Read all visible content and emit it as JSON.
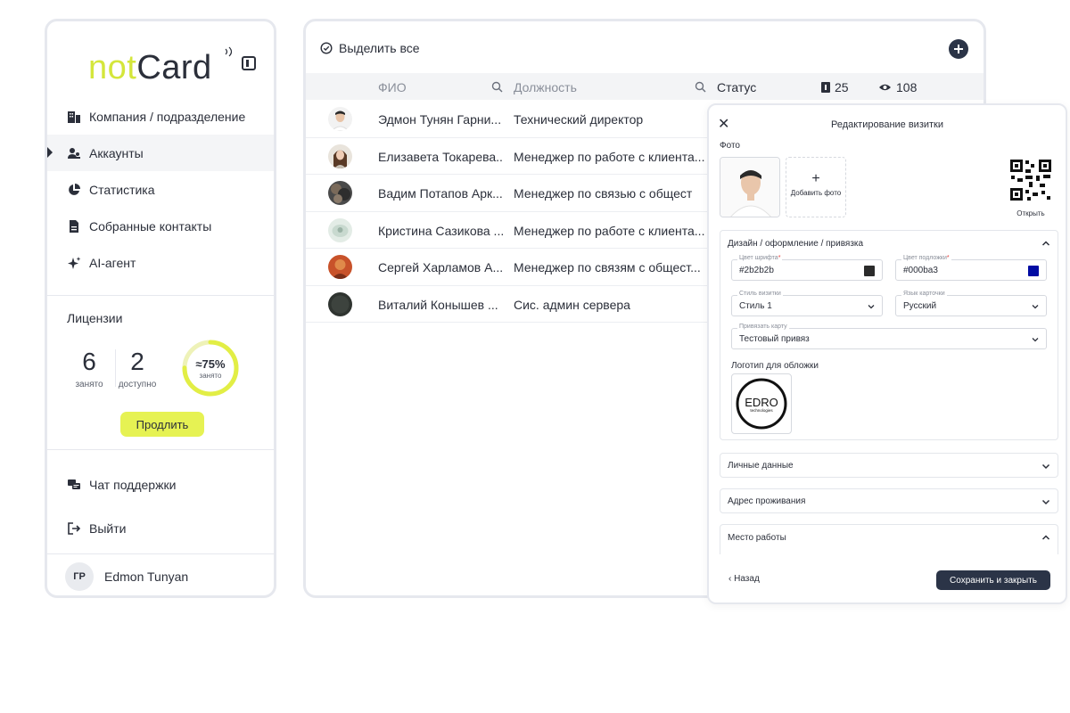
{
  "sidebar": {
    "logo_not": "not",
    "logo_card": "Card",
    "items": [
      {
        "label": "Компания / подразделение",
        "icon": "building-icon"
      },
      {
        "label": "Аккаунты",
        "icon": "users-icon"
      },
      {
        "label": "Статистика",
        "icon": "pie-chart-icon"
      },
      {
        "label": "Собранные контакты",
        "icon": "document-icon"
      },
      {
        "label": "AI-агент",
        "icon": "sparkle-icon"
      }
    ],
    "licenses": {
      "title": "Лицензии",
      "used": "6",
      "used_label": "занято",
      "available": "2",
      "available_label": "доступно",
      "percent_text": "≈75%",
      "percent_label": "занято",
      "percent_value": 75,
      "renew_label": "Продлить"
    },
    "support_label": "Чат поддержки",
    "logout_label": "Выйти",
    "user": {
      "initials": "ГР",
      "name": "Edmon Tunyan"
    }
  },
  "main": {
    "select_all_label": "Выделить все",
    "columns": {
      "fio": "ФИО",
      "position": "Должность",
      "status": "Статус"
    },
    "counts": {
      "cards": "25",
      "views": "108"
    },
    "rows": [
      {
        "fio": "Эдмон Тунян Гарни...",
        "position": "Технический директор"
      },
      {
        "fio": "Елизавета Токарева...",
        "position": "Менеджер по работе с клиента..."
      },
      {
        "fio": "Вадим Потапов Арк...",
        "position": "Менеджер по связью с общест"
      },
      {
        "fio": "Кристина Сазикова ...",
        "position": "Менеджер по работе с клиента..."
      },
      {
        "fio": "Сергей Харламов А...",
        "position": "Менеджер по связям с общест..."
      },
      {
        "fio": "Виталий Конышев ...",
        "position": "Сис. админ сервера"
      }
    ]
  },
  "modal": {
    "title": "Редактирование визитки",
    "photo_label": "Фото",
    "add_photo_label": "Добавить фото",
    "qr_label": "Открыть",
    "design_section": "Дизайн / оформление / привязка",
    "font_color_label": "Цвет шрифта",
    "font_color_value": "#2b2b2b",
    "bg_color_label": "Цвет подложки",
    "bg_color_value": "#000ba3",
    "style_label": "Стиль визитки",
    "style_value": "Стиль 1",
    "lang_label": "Язык карточки",
    "lang_value": "Русский",
    "bind_label": "Привязать карту",
    "bind_value": "Тестовый привяз",
    "cover_logo_label": "Логотип для обложки",
    "cover_logo_text": "EDRO",
    "cover_logo_sub": "technologies",
    "section_personal": "Личные данные",
    "section_address": "Адрес проживания",
    "section_work": "Место работы",
    "back_label": "Назад",
    "save_label": "Сохранить и закрыть"
  },
  "colors": {
    "accent": "#e6f253",
    "logo_accent": "#d4e63b",
    "dark": "#2b3447",
    "font_swatch": "#2b2b2b",
    "bg_swatch": "#000ba3"
  }
}
